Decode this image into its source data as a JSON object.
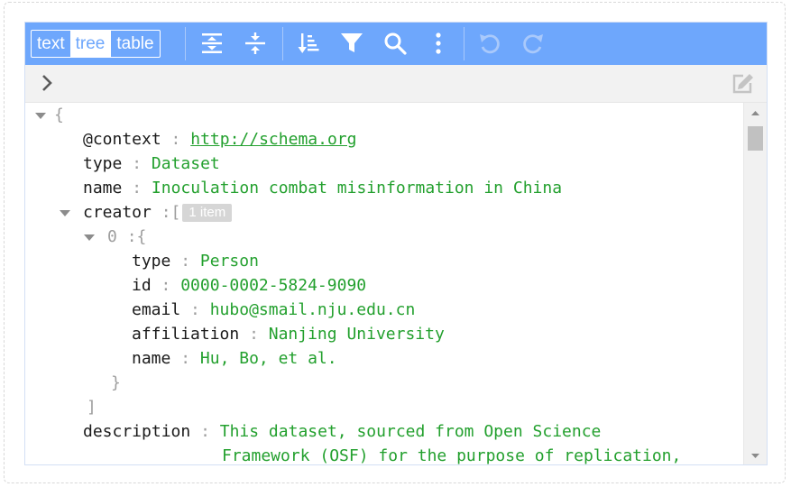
{
  "menu": {
    "modes": [
      {
        "label": "text",
        "active": false
      },
      {
        "label": "tree",
        "active": true
      },
      {
        "label": "table",
        "active": false
      }
    ],
    "buttons": [
      "expand-all-icon",
      "collapse-all-icon",
      "sort-icon",
      "filter-icon",
      "search-icon",
      "more-icon",
      "undo-icon",
      "redo-icon"
    ]
  },
  "colors": {
    "menu_bg": "#6ea7fc",
    "string_value": "#23a02e",
    "key": "#1a1a1a",
    "punctuation": "#9e9e9e"
  },
  "tree": {
    "root_open": "{",
    "context": {
      "key": "@context",
      "value": "http://schema.org"
    },
    "type": {
      "key": "type",
      "value": "Dataset"
    },
    "name": {
      "key": "name",
      "value": "Inoculation combat misinformation in China"
    },
    "creator": {
      "key": "creator",
      "bracket": "[",
      "badge": "1 item",
      "item_index": "0",
      "item_open": "{",
      "item_close": "}",
      "close": "]",
      "fields": {
        "type": {
          "key": "type",
          "value": "Person"
        },
        "id": {
          "key": "id",
          "value": "0000-0002-5824-9090"
        },
        "email": {
          "key": "email",
          "value": "hubo@smail.nju.edu.cn"
        },
        "affiliation": {
          "key": "affiliation",
          "value": "Nanjing University"
        },
        "name": {
          "key": "name",
          "value": "Hu, Bo, et al."
        }
      }
    },
    "description": {
      "key": "description",
      "line1": "This dataset, sourced from Open Science",
      "line2": "Framework (OSF) for the purpose of replication,"
    },
    "separator": ":"
  }
}
